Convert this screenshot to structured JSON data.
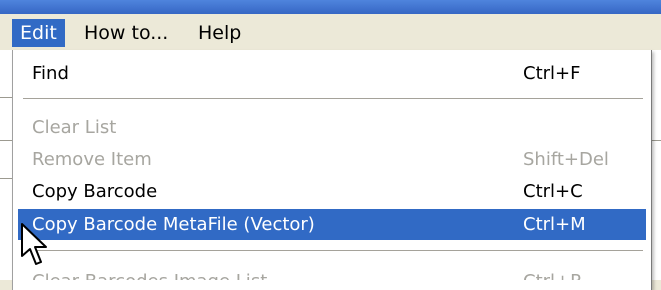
{
  "menubar": {
    "items": [
      {
        "label": "Edit",
        "active": true
      },
      {
        "label": "How to...",
        "active": false
      },
      {
        "label": "Help",
        "active": false
      }
    ]
  },
  "edit_menu": {
    "items": [
      {
        "label": "Find",
        "shortcut": "Ctrl+F",
        "state": "enabled"
      },
      {
        "label": "Clear List",
        "shortcut": "",
        "state": "disabled"
      },
      {
        "label": "Remove Item",
        "shortcut": "Shift+Del",
        "state": "disabled"
      },
      {
        "label": "Copy Barcode",
        "shortcut": "Ctrl+C",
        "state": "enabled"
      },
      {
        "label": "Copy Barcode MetaFile (Vector)",
        "shortcut": "Ctrl+M",
        "state": "highlighted"
      },
      {
        "label": "Clear Barcodes Image List",
        "shortcut": "Ctrl+R",
        "state": "disabled"
      }
    ]
  },
  "colors": {
    "highlight": "#316ac5",
    "menu_background": "#ffffff",
    "menubar_background": "#ece9d8",
    "disabled_text": "#a7a6a0"
  },
  "icons": {
    "cursor": "arrow-pointer-icon"
  }
}
